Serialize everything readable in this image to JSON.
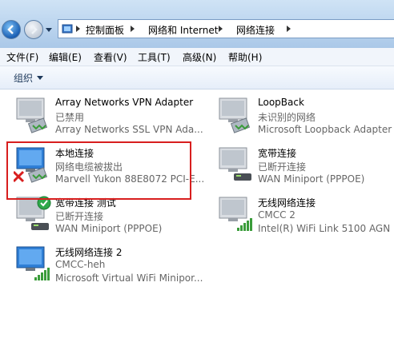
{
  "breadcrumb": [
    "控制面板",
    "网络和 Internet",
    "网络连接"
  ],
  "menu": [
    "文件(F)",
    "编辑(E)",
    "查看(V)",
    "工具(T)",
    "高级(N)",
    "帮助(H)"
  ],
  "toolbar": {
    "organize_label": "组织"
  },
  "connections": [
    {
      "name": "Array Networks VPN Adapter",
      "status": "已禁用",
      "device": "Array Networks SSL VPN Ada...",
      "icon": "network-adapter-icon"
    },
    {
      "name": "LoopBack",
      "status": "未识别的网络",
      "device": "Microsoft Loopback Adapter",
      "icon": "network-adapter-icon"
    },
    {
      "name": "本地连接",
      "status": "网络电缆被拔出",
      "device": "Marvell Yukon 88E8072 PCI-E...",
      "icon": "network-disconnected-icon"
    },
    {
      "name": "宽带连接",
      "status": "已断开连接",
      "device": "WAN Miniport (PPPOE)",
      "icon": "broadband-icon"
    },
    {
      "name": "宽带连接 测试",
      "status": "已断开连接",
      "device": "WAN Miniport (PPPOE)",
      "icon": "broadband-default-icon"
    },
    {
      "name": "无线网络连接",
      "status": "CMCC  2",
      "device": "Intel(R) WiFi Link 5100 AGN",
      "icon": "wireless-icon"
    },
    {
      "name": "无线网络连接 2",
      "status": "CMCC-heh",
      "device": "Microsoft Virtual WiFi Minipor...",
      "icon": "wireless-icon"
    }
  ],
  "colors": {
    "highlight": "#d81e1e",
    "status_text": "#666666"
  }
}
